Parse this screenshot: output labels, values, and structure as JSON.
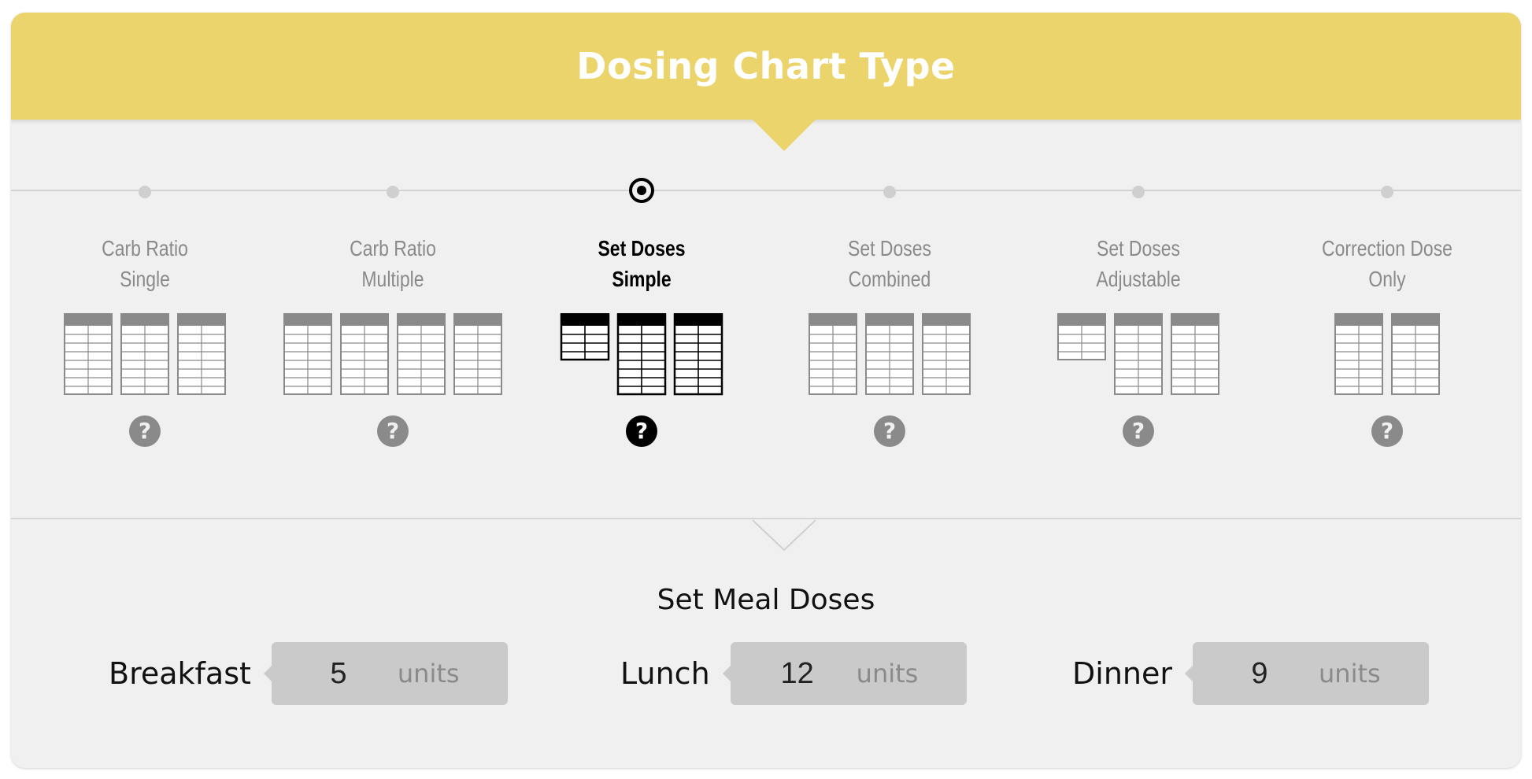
{
  "header": {
    "title": "Dosing Chart Type"
  },
  "chart_types": {
    "selected_index": 2,
    "options": [
      {
        "label_line1": "Carb Ratio",
        "label_line2": "Single",
        "help": "?",
        "tables": [
          {
            "rows": 8,
            "offset_rows": 0
          },
          {
            "rows": 8,
            "offset_rows": 0
          },
          {
            "rows": 8,
            "offset_rows": 0
          }
        ]
      },
      {
        "label_line1": "Carb Ratio",
        "label_line2": "Multiple",
        "help": "?",
        "tables": [
          {
            "rows": 8,
            "offset_rows": 0
          },
          {
            "rows": 8,
            "offset_rows": 0
          },
          {
            "rows": 8,
            "offset_rows": 0
          },
          {
            "rows": 8,
            "offset_rows": 0
          }
        ]
      },
      {
        "label_line1": "Set Doses",
        "label_line2": "Simple",
        "help": "?",
        "tables": [
          {
            "rows": 4,
            "offset_rows": 0
          },
          {
            "rows": 8,
            "offset_rows": 0
          },
          {
            "rows": 8,
            "offset_rows": 0
          }
        ]
      },
      {
        "label_line1": "Set Doses",
        "label_line2": "Combined",
        "help": "?",
        "tables": [
          {
            "rows": 8,
            "offset_rows": 0
          },
          {
            "rows": 8,
            "offset_rows": 0
          },
          {
            "rows": 8,
            "offset_rows": 0
          }
        ]
      },
      {
        "label_line1": "Set Doses",
        "label_line2": "Adjustable",
        "help": "?",
        "tables": [
          {
            "rows": 4,
            "offset_rows": 0
          },
          {
            "rows": 8,
            "offset_rows": 0
          },
          {
            "rows": 8,
            "offset_rows": 0
          }
        ]
      },
      {
        "label_line1": "Correction Dose",
        "label_line2": "Only",
        "help": "?",
        "tables": [
          {
            "rows": 8,
            "offset_rows": 0
          },
          {
            "rows": 8,
            "offset_rows": 0
          }
        ]
      }
    ]
  },
  "meal_doses": {
    "title": "Set Meal Doses",
    "meals": [
      {
        "label": "Breakfast",
        "value": "5",
        "unit": "units"
      },
      {
        "label": "Lunch",
        "value": "12",
        "unit": "units"
      },
      {
        "label": "Dinner",
        "value": "9",
        "unit": "units"
      }
    ]
  },
  "colors": {
    "header": "#ebd46c",
    "panel": "#f0f0f0",
    "inactive": "#8a8a8a",
    "active": "#000000",
    "input_bg": "#cacaca"
  },
  "icons": {
    "help": "question-circle-icon",
    "radio": "radio-selected-icon"
  }
}
